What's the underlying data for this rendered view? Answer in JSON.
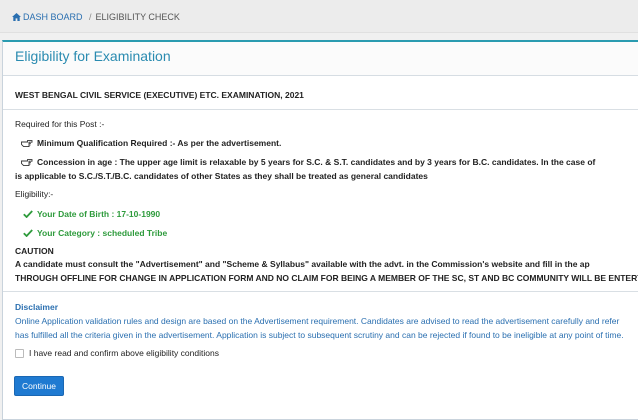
{
  "breadcrumb": {
    "home_label": "DASH BOARD",
    "separator": "/",
    "current": "ELIGIBILITY CHECK"
  },
  "panel": {
    "title": "Eligibility for Examination"
  },
  "exam": {
    "name": "WEST BENGAL CIVIL SERVICE (EXECUTIVE) ETC. EXAMINATION, 2021"
  },
  "requirements": {
    "heading": "Required for this Post :-",
    "min_qualification": "Minimum Qualification Required :- As per the advertisement.",
    "concession_line1": "Concession in age : The upper age limit is relaxable by 5 years for S.C. & S.T. candidates and by 3 years for B.C. candidates. In the case of",
    "concession_line2": "is applicable to S.C./S.T./B.C. candidates of other States as they shall be treated as general candidates"
  },
  "eligibility": {
    "heading": "Eligibility:-",
    "dob": "Your Date of Birth : 17-10-1990",
    "category": "Your Category : scheduled Tribe"
  },
  "caution": {
    "heading": "CAUTION",
    "line1": "A candidate must consult the \"Advertisement\" and \"Scheme & Syllabus\" available with the advt. in the Commission's website and fill in the ap",
    "line2": "THROUGH OFFLINE FOR CHANGE IN APPLICATION FORM AND NO CLAIM FOR BEING A MEMBER OF THE SC, ST AND BC COMMUNITY WILL BE ENTERTAI"
  },
  "disclaimer": {
    "heading": "Disclaimer",
    "line1": "Online Application validation rules and design are based on the Advertisement requirement. Candidates are advised to read the advertisement carefully and refer",
    "line2": "has fulfilled all the criteria given in the advertisement. Application is subject to subsequent scrutiny and can be rejected if found to be ineligible at any point of time."
  },
  "confirm": {
    "checkbox_label": "I have read and confirm above eligibility conditions",
    "checked": false
  },
  "actions": {
    "continue_label": "Continue"
  },
  "colors": {
    "accent": "#2a8bb0",
    "button": "#1f7ad1",
    "success": "#2e9b3c"
  },
  "icons": {
    "home": "home-icon",
    "pointer": "hand-pointer-icon",
    "check": "check-icon"
  }
}
